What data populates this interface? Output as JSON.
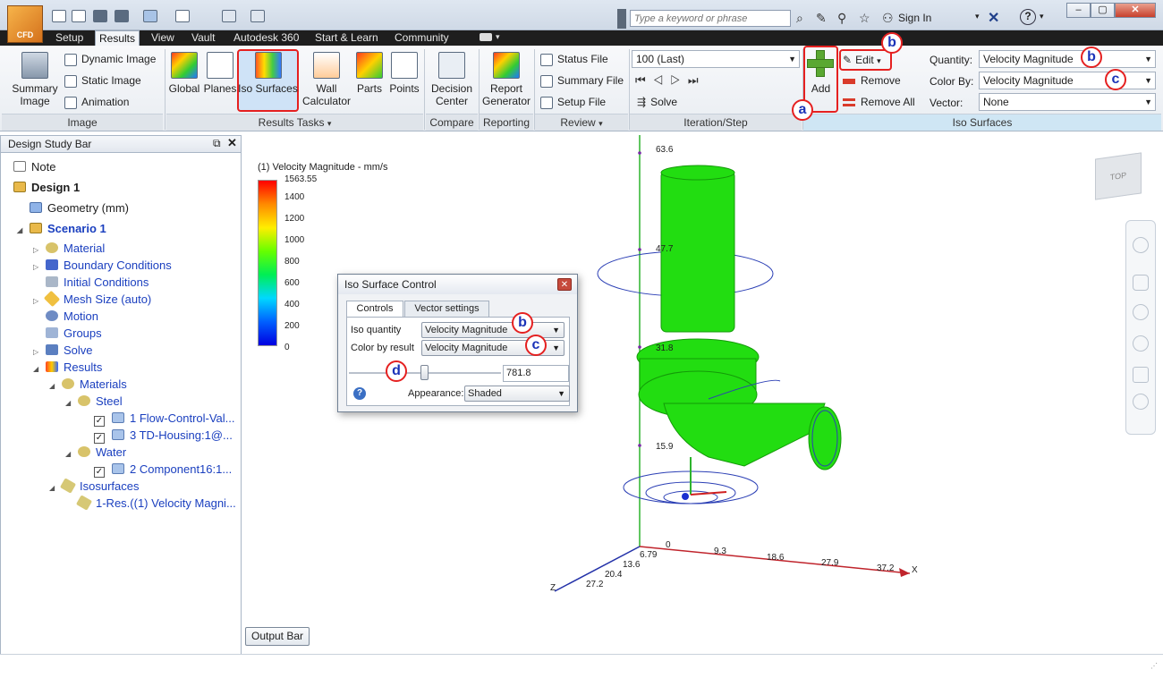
{
  "app": {
    "logo_text": "CFD"
  },
  "search": {
    "placeholder": "Type a keyword or phrase"
  },
  "topbar": {
    "sign_in": "Sign In",
    "help": "?"
  },
  "tabs": [
    "Setup",
    "Results",
    "View",
    "Vault",
    "Autodesk 360",
    "Start & Learn",
    "Community"
  ],
  "active_tab": "Results",
  "ribbon": {
    "image_group": {
      "label": "Image",
      "summary_image": "Summary Image",
      "dynamic_image": "Dynamic Image",
      "static_image": "Static Image",
      "animation": "Animation"
    },
    "results_tasks": {
      "label": "Results Tasks",
      "global": "Global",
      "planes": "Planes",
      "iso_surfaces": "Iso Surfaces",
      "wall_calculator": "Wall Calculator",
      "parts": "Parts",
      "points": "Points"
    },
    "compare": {
      "label": "Compare",
      "decision_center": "Decision Center"
    },
    "reporting": {
      "label": "Reporting",
      "report_generator": "Report Generator"
    },
    "review": {
      "label": "Review",
      "status_file": "Status File",
      "summary_file": "Summary File",
      "setup_file": "Setup File"
    },
    "iteration": {
      "label": "Iteration/Step",
      "step_value": "100 (Last)",
      "solve": "Solve"
    },
    "iso_surfaces": {
      "label": "Iso Surfaces",
      "add": "Add",
      "edit": "Edit",
      "remove": "Remove",
      "remove_all": "Remove All",
      "quantity_label": "Quantity:",
      "quantity_value": "Velocity Magnitude",
      "color_by_label": "Color By:",
      "color_by_value": "Velocity Magnitude",
      "vector_label": "Vector:",
      "vector_value": "None"
    }
  },
  "callouts": {
    "a": "a",
    "b": "b",
    "c": "c",
    "d": "d"
  },
  "design_study_bar": {
    "title": "Design Study Bar",
    "nodes": [
      {
        "label": "Note"
      },
      {
        "label": "Design 1"
      },
      {
        "label": "Geometry (mm)"
      },
      {
        "label": "Scenario 1"
      },
      {
        "label": "Material"
      },
      {
        "label": "Boundary Conditions"
      },
      {
        "label": "Initial Conditions"
      },
      {
        "label": "Mesh Size (auto)"
      },
      {
        "label": "Motion"
      },
      {
        "label": "Groups"
      },
      {
        "label": "Solve"
      },
      {
        "label": "Results"
      },
      {
        "label": "Materials"
      },
      {
        "label": "Steel"
      },
      {
        "label": "1 Flow-Control-Val..."
      },
      {
        "label": "3 TD-Housing:1@..."
      },
      {
        "label": "Water"
      },
      {
        "label": "2 Component16:1..."
      },
      {
        "label": "Isosurfaces"
      },
      {
        "label": "1-Res.((1) Velocity Magni..."
      }
    ]
  },
  "legend": {
    "title": "(1) Velocity Magnitude - mm/s",
    "ticks": [
      "1563.55",
      "1400",
      "1200",
      "1000",
      "800",
      "600",
      "400",
      "200",
      "0"
    ],
    "colors": [
      "#ff0000",
      "#ff8a00",
      "#ffee00",
      "#66ff00",
      "#00ee55",
      "#00d8ff",
      "#0060ff",
      "#0000e0"
    ]
  },
  "axes": {
    "y_labels": [
      "63.6",
      "47.7",
      "31.8",
      "15.9"
    ],
    "x_labels": [
      "0",
      "9.3",
      "18.6",
      "27.9",
      "37.2",
      "X"
    ],
    "z_labels": [
      "6.79",
      "13.6",
      "20.4",
      "27.2",
      "Z"
    ]
  },
  "viewcube": {
    "label": "TOP"
  },
  "output_bar": "Output Bar",
  "dialog": {
    "title": "Iso Surface Control",
    "tab_controls": "Controls",
    "tab_vector": "Vector settings",
    "iso_quantity_label": "Iso quantity",
    "iso_quantity_value": "Velocity Magnitude",
    "color_by_label": "Color by result",
    "color_by_value": "Velocity Magnitude",
    "slider_value": "781.8",
    "appearance_label": "Appearance:",
    "appearance_value": "Shaded"
  },
  "colors": {
    "accent_red": "#e52020",
    "callout_text": "#1b33b8",
    "isosurface": "#22dd11",
    "tree_link": "#1a3fbf"
  }
}
